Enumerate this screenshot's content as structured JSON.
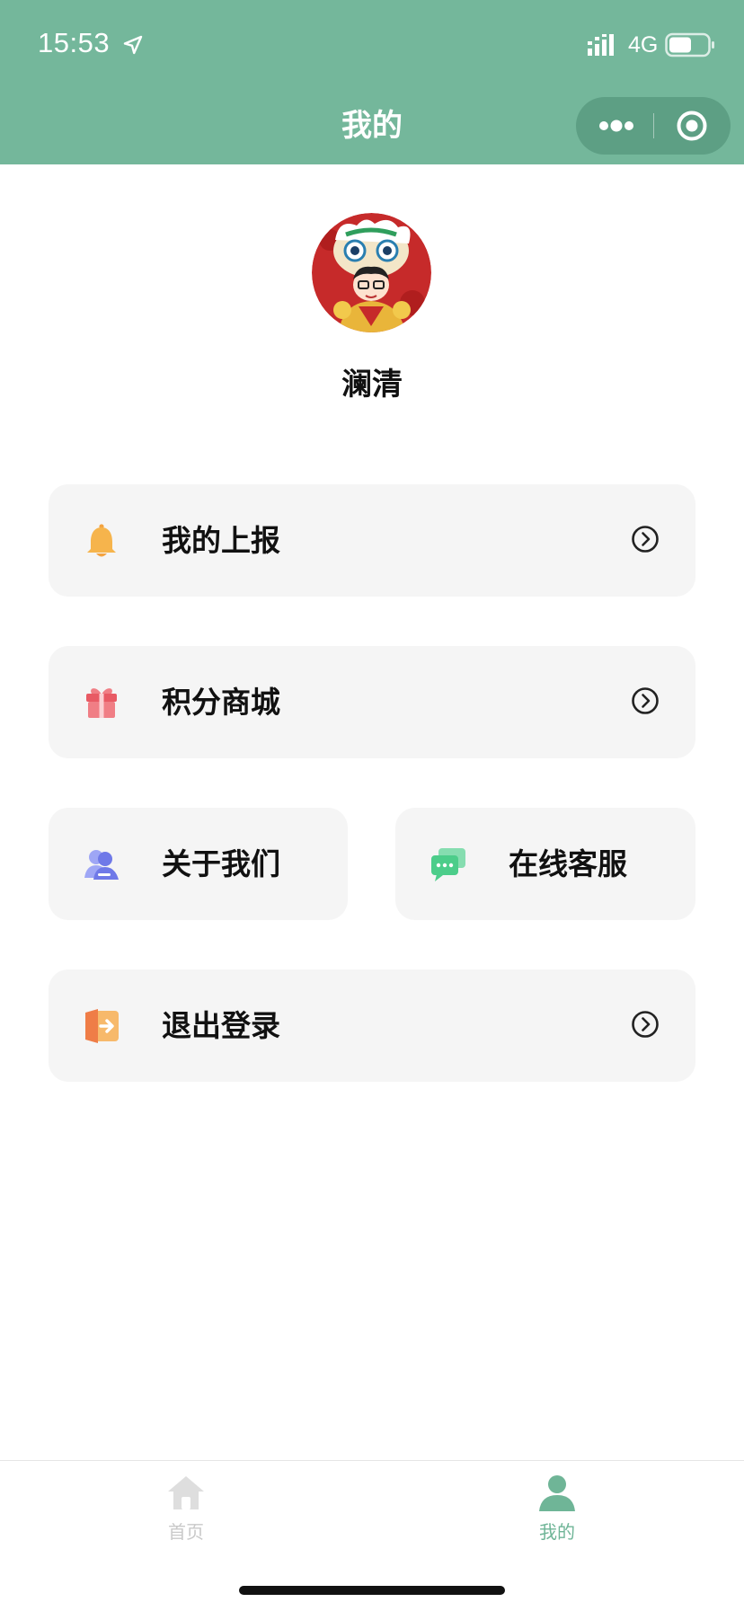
{
  "status_bar": {
    "time": "15:53",
    "network": "4G",
    "icons": [
      "location-arrow-icon",
      "signal-icon",
      "battery-icon"
    ]
  },
  "nav": {
    "title": "我的",
    "capsule_icons": [
      "more-dots-icon",
      "close-target-icon"
    ]
  },
  "profile": {
    "username": "澜清"
  },
  "menu": {
    "reports": {
      "label": "我的上报",
      "icon": "bell-icon"
    },
    "points_mall": {
      "label": "积分商城",
      "icon": "gift-icon"
    },
    "about_us": {
      "label": "关于我们",
      "icon": "user-group-icon"
    },
    "online_service": {
      "label": "在线客服",
      "icon": "chat-bubbles-icon"
    },
    "logout": {
      "label": "退出登录",
      "icon": "exit-door-icon"
    }
  },
  "tabbar": {
    "home": {
      "label": "首页",
      "icon": "home-icon",
      "active": false
    },
    "mine": {
      "label": "我的",
      "icon": "person-icon",
      "active": true
    }
  },
  "colors": {
    "header_bg": "#74b79b",
    "capsule_bg": "#5d9f84",
    "card_bg": "#f5f5f5",
    "tab_active": "#6fb597",
    "tab_inactive": "#c9c9c9"
  }
}
